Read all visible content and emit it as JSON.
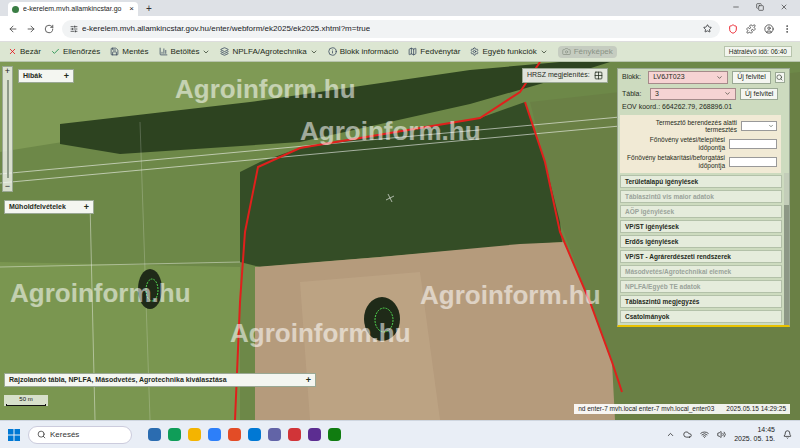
{
  "browser": {
    "tab": {
      "title": "e-kerelem.mvh.allamkincstar.go",
      "close": "×"
    },
    "new_tab": "+",
    "url": "e-kerelem.mvh.allamkincstar.gov.hu/enter/webform/ek2025/ek2025.xhtml?m=true"
  },
  "toolbar": {
    "items": [
      {
        "label": "Bezár",
        "dropdown": false,
        "disabled": false
      },
      {
        "label": "Ellenőrzés",
        "dropdown": false,
        "disabled": false
      },
      {
        "label": "Mentés",
        "dropdown": false,
        "disabled": false
      },
      {
        "label": "Betöltés",
        "dropdown": true,
        "disabled": false
      },
      {
        "label": "NPLFA/Agrotechnika",
        "dropdown": true,
        "disabled": false
      },
      {
        "label": "Blokk információ",
        "dropdown": false,
        "disabled": false
      },
      {
        "label": "Fedvénytár",
        "dropdown": false,
        "disabled": false
      },
      {
        "label": "Egyéb funkciók",
        "dropdown": true,
        "disabled": false
      },
      {
        "label": "Fényképek",
        "dropdown": false,
        "disabled": true
      }
    ],
    "timer": "Hátralévő idő: 06:40"
  },
  "map": {
    "watermark": "Agroinform.hu",
    "hrsz_label": "HRSZ megjelenítés:",
    "zoom_in": "+",
    "zoom_out": "−",
    "panels": [
      {
        "title": "Hibák",
        "toggle": "+"
      },
      {
        "title": "Műholdfelvételek",
        "toggle": "+"
      },
      {
        "title": "Rajzolandó tábla, NPLFA, Másodvetés, Agrotechnika kiválasztása",
        "toggle": "+"
      }
    ],
    "scale": "50 m"
  },
  "side_panel": {
    "block": {
      "label": "Blokk:",
      "value": "LV6JT023",
      "button": "Új felvitel"
    },
    "table": {
      "label": "Tábla:",
      "value": "3",
      "button": "Új felvitel"
    },
    "eov": "EOV koord.: 664262.79, 268896.01",
    "fields": [
      {
        "label": "Termesztő berendezés alatti termesztés",
        "kind": "select",
        "value": ""
      },
      {
        "label": "Főnövény vetési/telepítési időpontja",
        "kind": "input",
        "value": ""
      },
      {
        "label": "Főnövény betakarítási/beforgatási időpontja",
        "kind": "input",
        "value": ""
      }
    ],
    "sections": [
      {
        "label": "Területalapú igénylések",
        "disabled": false
      },
      {
        "label": "Táblaszintű vis maior adatok",
        "disabled": true
      },
      {
        "label": "AÖP igénylések",
        "disabled": true
      },
      {
        "label": "VP/ST igénylések",
        "disabled": false
      },
      {
        "label": "Erdős igénylések",
        "disabled": false
      },
      {
        "label": "VP/ST - Agrárerdészeti rendszerek",
        "disabled": false
      },
      {
        "label": "Másodvetés/Agrotechnikai elemek",
        "disabled": true
      },
      {
        "label": "NPLFA/Egyéb TE adatok",
        "disabled": true
      },
      {
        "label": "Táblaszintű megjegyzés",
        "disabled": false
      },
      {
        "label": "Csatolmányok",
        "disabled": false
      }
    ]
  },
  "status_bar": {
    "server": "nd enter-7 mvh.local enter-7 mvh.local_enter03",
    "datetime": "2025.05.15 14:29:25"
  },
  "taskbar": {
    "search": "Keresés",
    "time": "14:45",
    "date": "2025. 05. 15."
  }
}
